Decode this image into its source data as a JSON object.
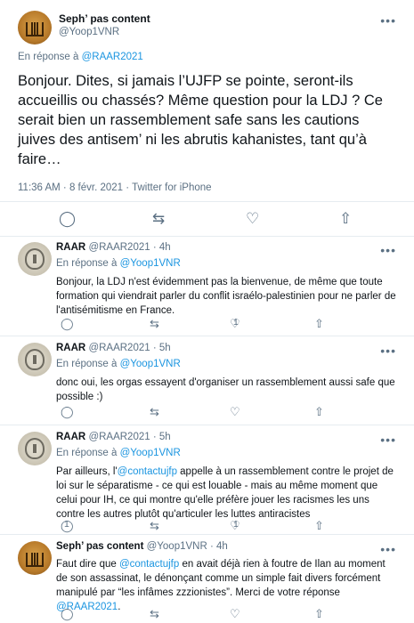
{
  "main": {
    "author_name": "Seph’ pas content",
    "author_handle": "@Yoop1VNR",
    "reply_prefix": "En réponse à ",
    "reply_to": "@RAAR2021",
    "text": "Bonjour. Dites, si jamais l’UJFP se pointe, seront-ils accueillis ou chassés? Même question pour la LDJ ? Ce serait bien un rassemblement safe sans les cautions juives des antisem’ ni les abrutis kahanistes, tant qu’à faire…",
    "timestamp": "11:36 AM · 8 févr. 2021 · Twitter for iPhone"
  },
  "icons": {
    "more": "•••",
    "reply": "◯",
    "retweet": "⇆",
    "like": "♡",
    "share": "⇧"
  },
  "replies": [
    {
      "name": "RAAR",
      "handle": "@RAAR2021 · 4h",
      "reply_prefix": "En réponse à ",
      "reply_to": "@Yoop1VNR",
      "text": "Bonjour, la LDJ n'est évidemment pas la bienvenue, de même que toute formation qui viendrait parler du conflit israélo-palestinien pour ne parler de l'antisémitisme en France.",
      "reply_count": "",
      "like_count": "1"
    },
    {
      "name": "RAAR",
      "handle": "@RAAR2021 · 5h",
      "reply_prefix": "En réponse à ",
      "reply_to": "@Yoop1VNR",
      "text": "donc oui, les orgas essayent d'organiser un rassemblement aussi safe que possible :)",
      "reply_count": "",
      "like_count": ""
    },
    {
      "name": "RAAR",
      "handle": "@RAAR2021 · 5h",
      "reply_prefix": "En réponse à ",
      "reply_to": "@Yoop1VNR",
      "text_before": "Par ailleurs, l'",
      "mention": "@contactujfp",
      "text_after": "  appelle à un rassemblement contre le projet de loi sur le séparatisme - ce qui est louable - mais au même moment que celui pour IH, ce qui montre qu'elle préfère jouer les racismes les uns contre les autres plutôt qu'articuler les luttes antiracistes",
      "reply_count": "1",
      "like_count": "1"
    },
    {
      "name": "Seph’ pas content",
      "handle": "@Yoop1VNR · 4h",
      "text_before": "Faut dire que ",
      "mention": "@contactujfp",
      "text_middle": " en avait déjà rien à foutre de Ilan au moment de son assassinat, le dénonçant comme un simple fait divers forcément manipulé par “les infâmes zzzionistes”. Merci de votre réponse ",
      "mention2": "@RAAR2021",
      "text_after": ".",
      "reply_count": "",
      "like_count": ""
    }
  ]
}
